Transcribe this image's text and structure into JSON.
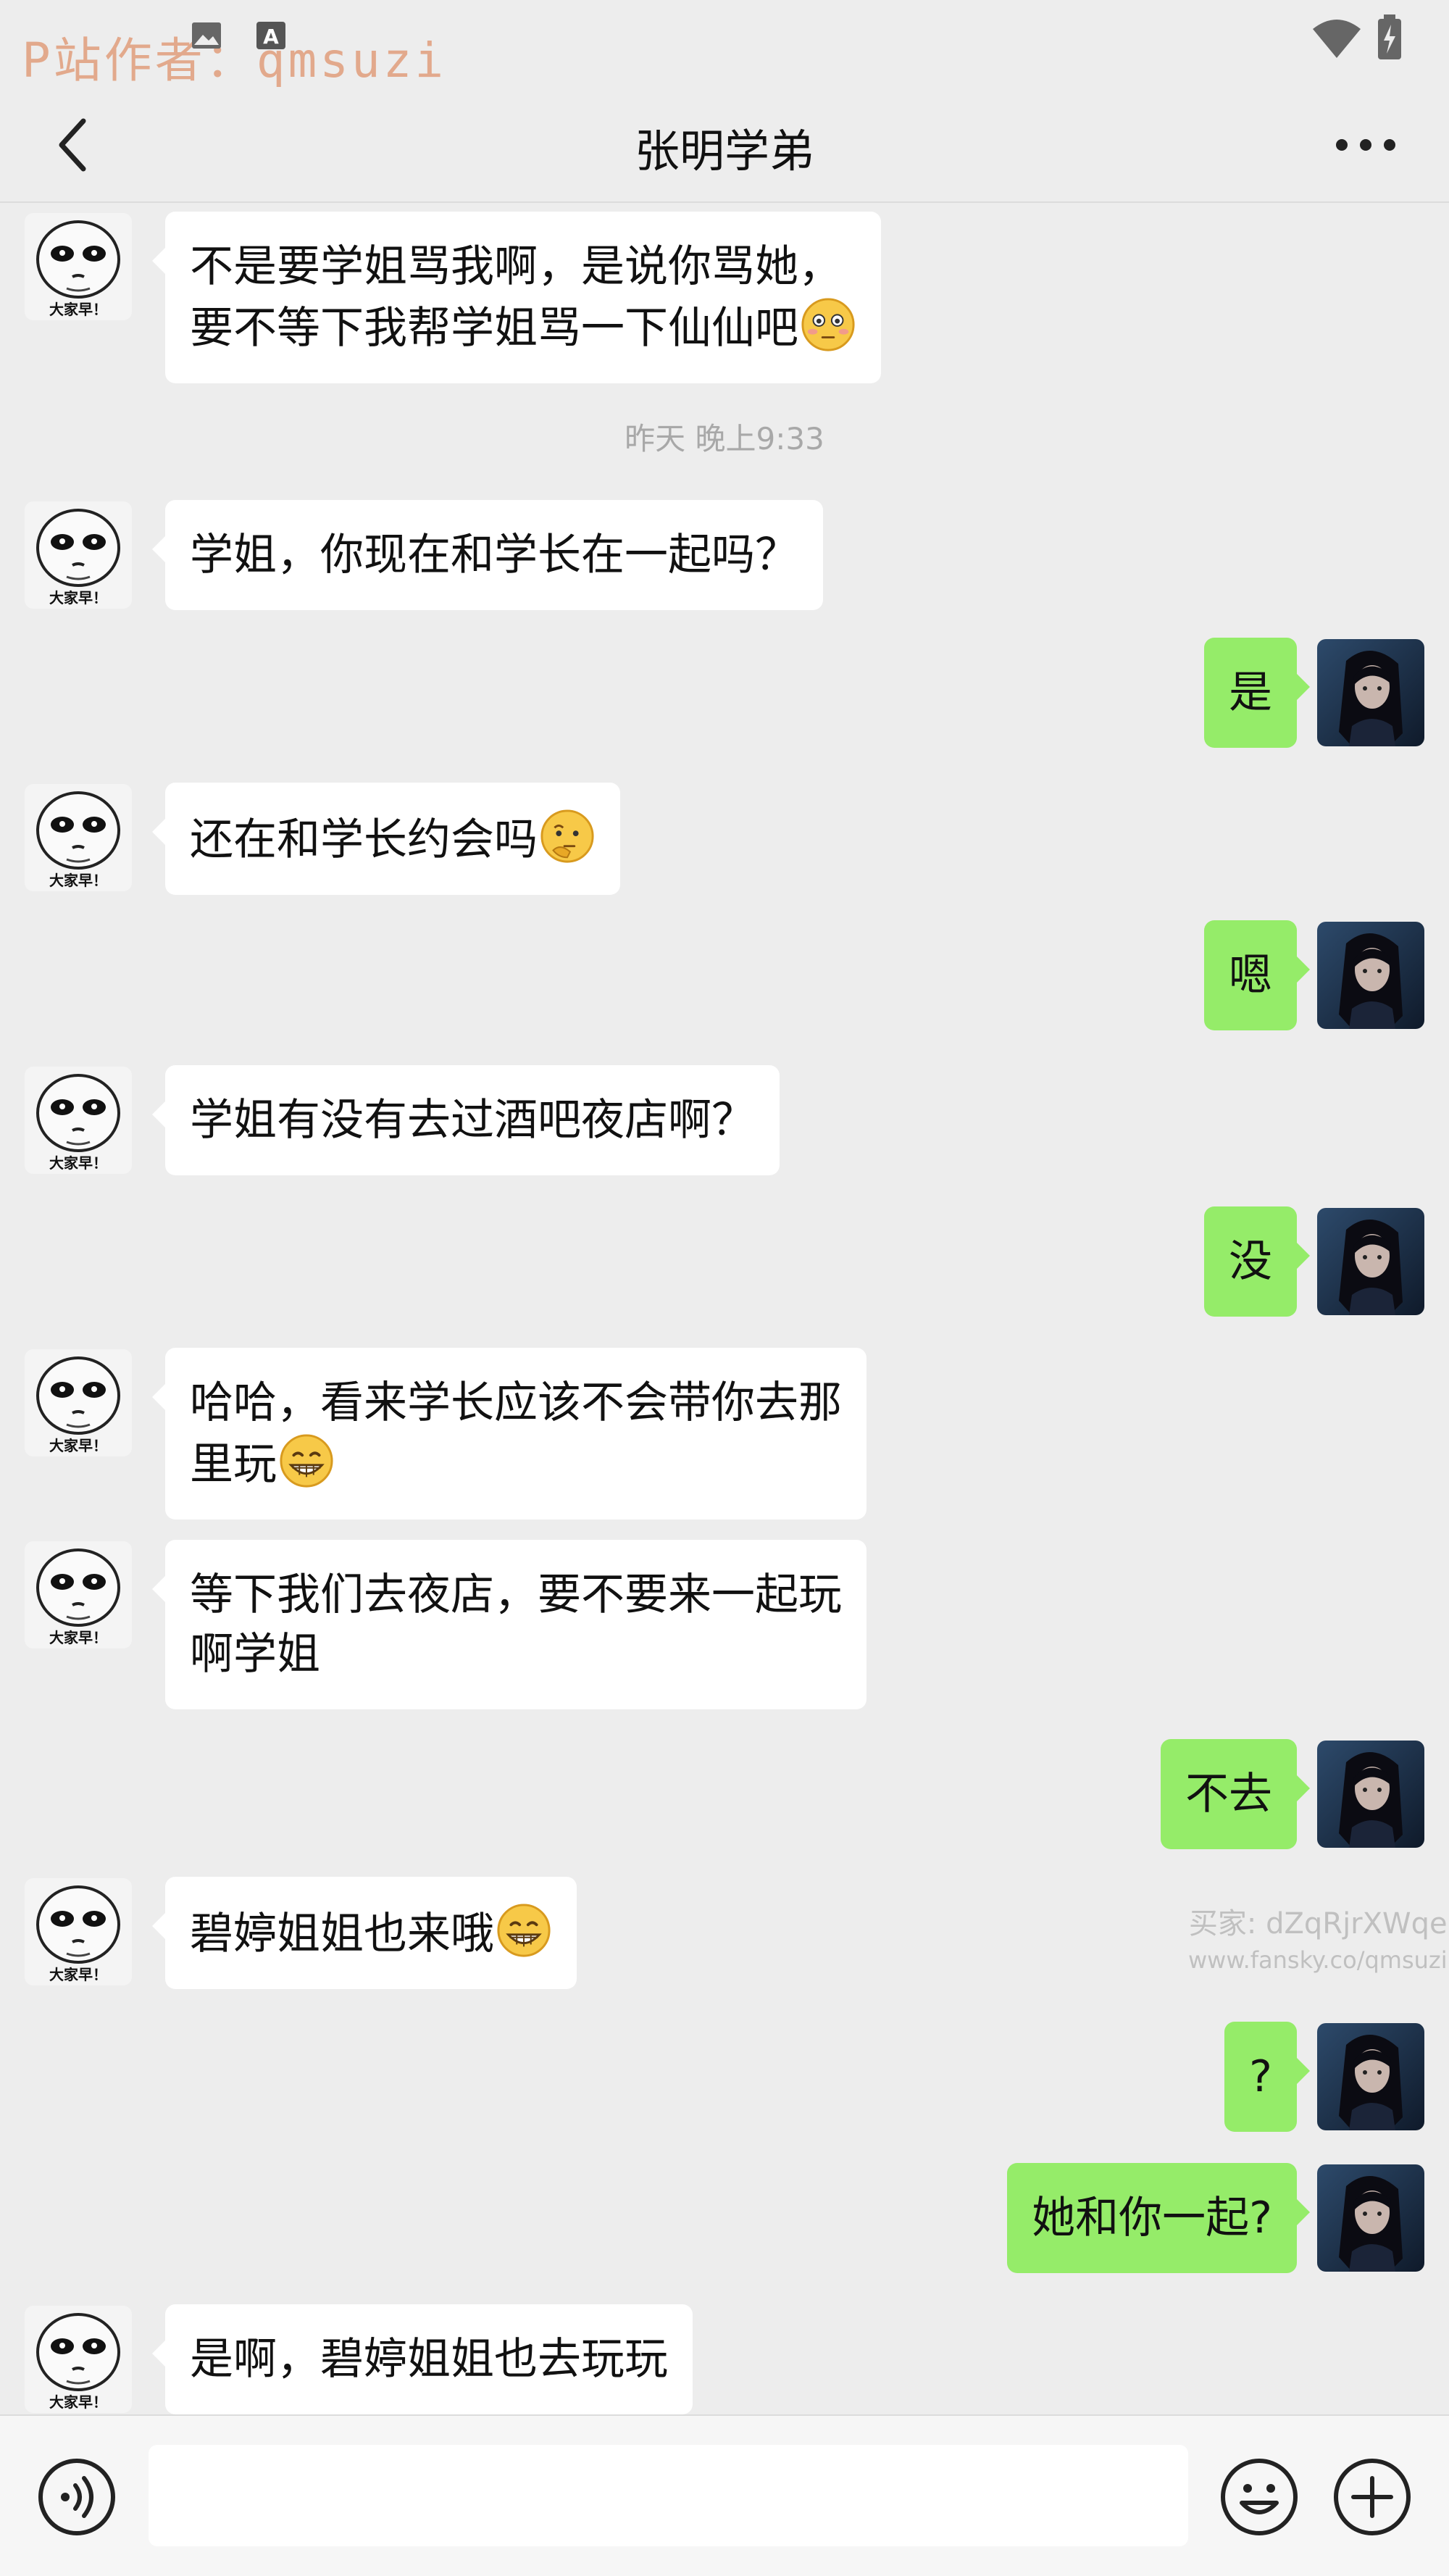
{
  "status_bar": {
    "watermark": "P站作者：qmsuzi",
    "icons": [
      "image-icon",
      "font-a-icon",
      "wifi-icon",
      "battery-icon"
    ]
  },
  "header": {
    "title": "张明学弟",
    "back_icon": "chevron-left-icon",
    "more_icon": "more-dots-icon"
  },
  "chat": {
    "timestamp": "昨天 晚上9:33",
    "messages": [
      {
        "side": "left",
        "lines": [
          "不是要学姐骂我啊，是说你骂她，",
          "要不等下我帮学姐骂一下仙仙吧"
        ],
        "emoji": "flushed-emoji"
      },
      {
        "side": "left",
        "lines": [
          "学姐，你现在和学长在一起吗？"
        ]
      },
      {
        "side": "right",
        "lines": [
          "是"
        ]
      },
      {
        "side": "left",
        "lines": [
          "还在和学长约会吗"
        ],
        "emoji": "thinking-emoji"
      },
      {
        "side": "right",
        "lines": [
          "嗯"
        ]
      },
      {
        "side": "left",
        "lines": [
          "学姐有没有去过酒吧夜店啊？"
        ]
      },
      {
        "side": "right",
        "lines": [
          "没"
        ]
      },
      {
        "side": "left",
        "lines": [
          "哈哈，看来学长应该不会带你去那",
          "里玩"
        ],
        "emoji": "grin-emoji"
      },
      {
        "side": "left",
        "lines": [
          "等下我们去夜店，要不要来一起玩",
          "啊学姐"
        ]
      },
      {
        "side": "right",
        "lines": [
          "不去"
        ]
      },
      {
        "side": "left",
        "lines": [
          "碧婷姐姐也来哦"
        ],
        "emoji": "grin-emoji"
      },
      {
        "side": "right",
        "lines": [
          "?"
        ]
      },
      {
        "side": "right",
        "lines": [
          "她和你一起?"
        ]
      },
      {
        "side": "left",
        "lines": [
          "是啊，碧婷姐姐也去玩玩"
        ]
      }
    ],
    "avatar_left_caption": "大家早！",
    "buyer_watermark": [
      "买家: dZqRjrXWqe",
      "www.fansky.co/qmsuzi"
    ]
  },
  "input_bar": {
    "voice_icon": "voice-icon",
    "input_value": "",
    "emoji_icon": "smiley-icon",
    "plus_icon": "plus-circle-icon"
  },
  "colors": {
    "background": "#ededed",
    "bubble_self": "#95ec69",
    "bubble_other": "#ffffff"
  }
}
